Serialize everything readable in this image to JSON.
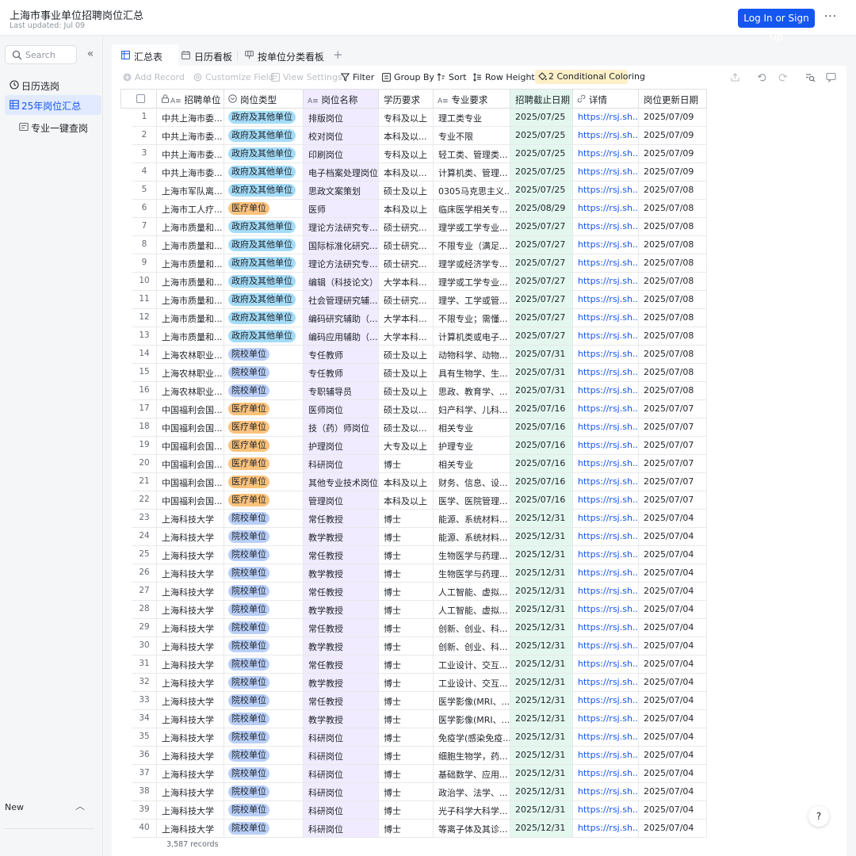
{
  "header": {
    "title": "上海市事业单位招聘岗位汇总",
    "subtitle": "Last updated: Jul 09",
    "login_label": "Log In or Sign Up",
    "more_label": "···"
  },
  "sidebar": {
    "search_placeholder": "Search",
    "collapse_label": "«",
    "items": [
      {
        "label": "日历选岗",
        "icon": "calendar-icon"
      },
      {
        "label": "25年岗位汇总",
        "icon": "table-icon",
        "active": true
      },
      {
        "label": "专业一键查岗",
        "icon": "form-icon"
      }
    ],
    "new_label": "New",
    "new_chevron": "︿"
  },
  "tabs": [
    {
      "label": "汇总表",
      "icon": "grid-icon",
      "active": true
    },
    {
      "label": "日历看板",
      "icon": "calendar-icon"
    },
    {
      "label": "按单位分类看板",
      "icon": "kanban-icon"
    }
  ],
  "tab_add": "+",
  "toolbar": {
    "add_record": "Add Record",
    "customize_field": "Customize Field",
    "view_settings": "View Settings",
    "filter": "Filter",
    "group_by": "Group By",
    "sort": "Sort",
    "row_height": "Row Height",
    "conditional_coloring": "2 Conditional Coloring"
  },
  "columns": [
    "招聘单位",
    "岗位类型",
    "岗位名称",
    "学历要求",
    "专业要求",
    "招聘截止日期",
    "详情",
    "岗位更新日期"
  ],
  "colors": {
    "accent": "#1456f0",
    "gov_tag": "#a4dcf8",
    "med_tag": "#fbc27c",
    "school_tag": "#b9cff8",
    "purple_col": "#f0ebfe",
    "green_col": "#e3f7ef"
  },
  "rows": [
    {
      "n": "1",
      "unit": "中共上海市委...",
      "type": "政府及其他单位",
      "kind": "gov",
      "name": "排版岗位",
      "edu": "专科及以上",
      "major": "理工类专业",
      "deadline": "2025/07/25",
      "link": "https://rsj.sh....",
      "updated": "2025/07/09"
    },
    {
      "n": "2",
      "unit": "中共上海市委...",
      "type": "政府及其他单位",
      "kind": "gov",
      "name": "校对岗位",
      "edu": "本科及以...",
      "major": "专业不限",
      "deadline": "2025/07/25",
      "link": "https://rsj.sh....",
      "updated": "2025/07/09"
    },
    {
      "n": "3",
      "unit": "中共上海市委...",
      "type": "政府及其他单位",
      "kind": "gov",
      "name": "印刷岗位",
      "edu": "专科及以上",
      "major": "轻工类、管理类...",
      "deadline": "2025/07/25",
      "link": "https://rsj.sh....",
      "updated": "2025/07/09"
    },
    {
      "n": "4",
      "unit": "中共上海市委...",
      "type": "政府及其他单位",
      "kind": "gov",
      "name": "电子档案处理岗位",
      "edu": "本科及以...",
      "major": "计算机类、管理...",
      "deadline": "2025/07/25",
      "link": "https://rsj.sh....",
      "updated": "2025/07/09"
    },
    {
      "n": "5",
      "unit": "上海市军队离...",
      "type": "政府及其他单位",
      "kind": "gov",
      "name": "思政文案策划",
      "edu": "硕士及以上",
      "major": "0305马克思主义...",
      "deadline": "2025/07/25",
      "link": "https://rsj.sh....",
      "updated": "2025/07/08"
    },
    {
      "n": "6",
      "unit": "上海市工人疗...",
      "type": "医疗单位",
      "kind": "med",
      "name": "医师",
      "edu": "本科及以上",
      "major": "临床医学相关专...",
      "deadline": "2025/08/29",
      "link": "https://rsj.sh....",
      "updated": "2025/07/08"
    },
    {
      "n": "7",
      "unit": "上海市质量和...",
      "type": "政府及其他单位",
      "kind": "gov",
      "name": "理论方法研究专...",
      "edu": "硕士研究...",
      "major": "理学或工学专业...",
      "deadline": "2025/07/27",
      "link": "https://rsj.sh....",
      "updated": "2025/07/08"
    },
    {
      "n": "8",
      "unit": "上海市质量和...",
      "type": "政府及其他单位",
      "kind": "gov",
      "name": "国际标准化研究...",
      "edu": "硕士研究...",
      "major": "不限专业（满足...",
      "deadline": "2025/07/27",
      "link": "https://rsj.sh....",
      "updated": "2025/07/08"
    },
    {
      "n": "9",
      "unit": "上海市质量和...",
      "type": "政府及其他单位",
      "kind": "gov",
      "name": "理论方法研究专...",
      "edu": "硕士研究...",
      "major": "理学或经济学专...",
      "deadline": "2025/07/27",
      "link": "https://rsj.sh....",
      "updated": "2025/07/08"
    },
    {
      "n": "10",
      "unit": "上海市质量和...",
      "type": "政府及其他单位",
      "kind": "gov",
      "name": "编辑（科技论文）",
      "edu": "大学本科...",
      "major": "理学或工学专业...",
      "deadline": "2025/07/27",
      "link": "https://rsj.sh....",
      "updated": "2025/07/08"
    },
    {
      "n": "11",
      "unit": "上海市质量和...",
      "type": "政府及其他单位",
      "kind": "gov",
      "name": "社会管理研究辅...",
      "edu": "硕士研究...",
      "major": "理学、工学或管...",
      "deadline": "2025/07/27",
      "link": "https://rsj.sh....",
      "updated": "2025/07/08"
    },
    {
      "n": "12",
      "unit": "上海市质量和...",
      "type": "政府及其他单位",
      "kind": "gov",
      "name": "编码研究辅助（...",
      "edu": "大学本科...",
      "major": "不限专业；需懂...",
      "deadline": "2025/07/27",
      "link": "https://rsj.sh....",
      "updated": "2025/07/08"
    },
    {
      "n": "13",
      "unit": "上海市质量和...",
      "type": "政府及其他单位",
      "kind": "gov",
      "name": "编码应用辅助（...",
      "edu": "大学本科...",
      "major": "计算机类或电子...",
      "deadline": "2025/07/27",
      "link": "https://rsj.sh....",
      "updated": "2025/07/08"
    },
    {
      "n": "14",
      "unit": "上海农林职业...",
      "type": "院校单位",
      "kind": "sch",
      "name": "专任教师",
      "edu": "硕士及以上",
      "major": "动物科学、动物...",
      "deadline": "2025/07/31",
      "link": "https://rsj.sh....",
      "updated": "2025/07/08"
    },
    {
      "n": "15",
      "unit": "上海农林职业...",
      "type": "院校单位",
      "kind": "sch",
      "name": "专任教师",
      "edu": "硕士及以上",
      "major": "具有生物学、生...",
      "deadline": "2025/07/31",
      "link": "https://rsj.sh....",
      "updated": "2025/07/08"
    },
    {
      "n": "16",
      "unit": "上海农林职业...",
      "type": "院校单位",
      "kind": "sch",
      "name": "专职辅导员",
      "edu": "硕士及以上",
      "major": "思政、教育学、...",
      "deadline": "2025/07/31",
      "link": "https://rsj.sh....",
      "updated": "2025/07/08"
    },
    {
      "n": "17",
      "unit": "中国福利会国...",
      "type": "医疗单位",
      "kind": "med",
      "name": "医师岗位",
      "edu": "硕士及以...",
      "major": "妇产科学、儿科...",
      "deadline": "2025/07/16",
      "link": "https://rsj.sh....",
      "updated": "2025/07/07"
    },
    {
      "n": "18",
      "unit": "中国福利会国...",
      "type": "医疗单位",
      "kind": "med",
      "name": "技（药）师岗位",
      "edu": "硕士及以...",
      "major": "相关专业",
      "deadline": "2025/07/16",
      "link": "https://rsj.sh....",
      "updated": "2025/07/07"
    },
    {
      "n": "19",
      "unit": "中国福利会国...",
      "type": "医疗单位",
      "kind": "med",
      "name": "护理岗位",
      "edu": "大专及以上",
      "major": "护理专业",
      "deadline": "2025/07/16",
      "link": "https://rsj.sh....",
      "updated": "2025/07/07"
    },
    {
      "n": "20",
      "unit": "中国福利会国...",
      "type": "医疗单位",
      "kind": "med",
      "name": "科研岗位",
      "edu": "博士",
      "major": "相关专业",
      "deadline": "2025/07/16",
      "link": "https://rsj.sh....",
      "updated": "2025/07/07"
    },
    {
      "n": "21",
      "unit": "中国福利会国...",
      "type": "医疗单位",
      "kind": "med",
      "name": "其他专业技术岗位",
      "edu": "本科及以上",
      "major": "财务、信息、设...",
      "deadline": "2025/07/16",
      "link": "https://rsj.sh....",
      "updated": "2025/07/07"
    },
    {
      "n": "22",
      "unit": "中国福利会国...",
      "type": "医疗单位",
      "kind": "med",
      "name": "管理岗位",
      "edu": "本科及以上",
      "major": "医学、医院管理...",
      "deadline": "2025/07/16",
      "link": "https://rsj.sh....",
      "updated": "2025/07/07"
    },
    {
      "n": "23",
      "unit": "上海科技大学",
      "type": "院校单位",
      "kind": "sch",
      "name": "常任教授",
      "edu": "博士",
      "major": "能源、系统材料...",
      "deadline": "2025/12/31",
      "link": "https://rsj.sh....",
      "updated": "2025/07/04"
    },
    {
      "n": "24",
      "unit": "上海科技大学",
      "type": "院校单位",
      "kind": "sch",
      "name": "教学教授",
      "edu": "博士",
      "major": "能源、系统材料...",
      "deadline": "2025/12/31",
      "link": "https://rsj.sh....",
      "updated": "2025/07/04"
    },
    {
      "n": "25",
      "unit": "上海科技大学",
      "type": "院校单位",
      "kind": "sch",
      "name": "常任教授",
      "edu": "博士",
      "major": "生物医学与药理...",
      "deadline": "2025/12/31",
      "link": "https://rsj.sh....",
      "updated": "2025/07/04"
    },
    {
      "n": "26",
      "unit": "上海科技大学",
      "type": "院校单位",
      "kind": "sch",
      "name": "教学教授",
      "edu": "博士",
      "major": "生物医学与药理...",
      "deadline": "2025/12/31",
      "link": "https://rsj.sh....",
      "updated": "2025/07/04"
    },
    {
      "n": "27",
      "unit": "上海科技大学",
      "type": "院校单位",
      "kind": "sch",
      "name": "常任教授",
      "edu": "博士",
      "major": "人工智能、虚拟...",
      "deadline": "2025/12/31",
      "link": "https://rsj.sh....",
      "updated": "2025/07/04"
    },
    {
      "n": "28",
      "unit": "上海科技大学",
      "type": "院校单位",
      "kind": "sch",
      "name": "教学教授",
      "edu": "博士",
      "major": "人工智能、虚拟...",
      "deadline": "2025/12/31",
      "link": "https://rsj.sh....",
      "updated": "2025/07/04"
    },
    {
      "n": "29",
      "unit": "上海科技大学",
      "type": "院校单位",
      "kind": "sch",
      "name": "常任教授",
      "edu": "博士",
      "major": "创新、创业、科...",
      "deadline": "2025/12/31",
      "link": "https://rsj.sh....",
      "updated": "2025/07/04"
    },
    {
      "n": "30",
      "unit": "上海科技大学",
      "type": "院校单位",
      "kind": "sch",
      "name": "教学教授",
      "edu": "博士",
      "major": "创新、创业、科...",
      "deadline": "2025/12/31",
      "link": "https://rsj.sh....",
      "updated": "2025/07/04"
    },
    {
      "n": "31",
      "unit": "上海科技大学",
      "type": "院校单位",
      "kind": "sch",
      "name": "常任教授",
      "edu": "博士",
      "major": "工业设计、交互...",
      "deadline": "2025/12/31",
      "link": "https://rsj.sh....",
      "updated": "2025/07/04"
    },
    {
      "n": "32",
      "unit": "上海科技大学",
      "type": "院校单位",
      "kind": "sch",
      "name": "教学教授",
      "edu": "博士",
      "major": "工业设计、交互...",
      "deadline": "2025/12/31",
      "link": "https://rsj.sh....",
      "updated": "2025/07/04"
    },
    {
      "n": "33",
      "unit": "上海科技大学",
      "type": "院校单位",
      "kind": "sch",
      "name": "常任教授",
      "edu": "博士",
      "major": "医学影像(MRI、...",
      "deadline": "2025/12/31",
      "link": "https://rsj.sh....",
      "updated": "2025/07/04"
    },
    {
      "n": "34",
      "unit": "上海科技大学",
      "type": "院校单位",
      "kind": "sch",
      "name": "教学教授",
      "edu": "博士",
      "major": "医学影像(MRI、...",
      "deadline": "2025/12/31",
      "link": "https://rsj.sh....",
      "updated": "2025/07/04"
    },
    {
      "n": "35",
      "unit": "上海科技大学",
      "type": "院校单位",
      "kind": "sch",
      "name": "科研岗位",
      "edu": "博士",
      "major": "免疫学(感染免疫...",
      "deadline": "2025/12/31",
      "link": "https://rsj.sh....",
      "updated": "2025/07/04"
    },
    {
      "n": "36",
      "unit": "上海科技大学",
      "type": "院校单位",
      "kind": "sch",
      "name": "科研岗位",
      "edu": "博士",
      "major": "细胞生物学，药...",
      "deadline": "2025/12/31",
      "link": "https://rsj.sh....",
      "updated": "2025/07/04"
    },
    {
      "n": "37",
      "unit": "上海科技大学",
      "type": "院校单位",
      "kind": "sch",
      "name": "科研岗位",
      "edu": "博士",
      "major": "基础数学、应用...",
      "deadline": "2025/12/31",
      "link": "https://rsj.sh....",
      "updated": "2025/07/04"
    },
    {
      "n": "38",
      "unit": "上海科技大学",
      "type": "院校单位",
      "kind": "sch",
      "name": "科研岗位",
      "edu": "博士",
      "major": "政治学、法学、...",
      "deadline": "2025/12/31",
      "link": "https://rsj.sh....",
      "updated": "2025/07/04"
    },
    {
      "n": "39",
      "unit": "上海科技大学",
      "type": "院校单位",
      "kind": "sch",
      "name": "科研岗位",
      "edu": "博士",
      "major": "光子科学大科学...",
      "deadline": "2025/12/31",
      "link": "https://rsj.sh....",
      "updated": "2025/07/04"
    },
    {
      "n": "40",
      "unit": "上海科技大学",
      "type": "院校单位",
      "kind": "sch",
      "name": "科研岗位",
      "edu": "博士",
      "major": "等离子体及其诊...",
      "deadline": "2025/12/31",
      "link": "https://rsj.sh....",
      "updated": "2025/07/04"
    }
  ],
  "footer": {
    "record_count": "3,587 records"
  },
  "help_label": "?"
}
